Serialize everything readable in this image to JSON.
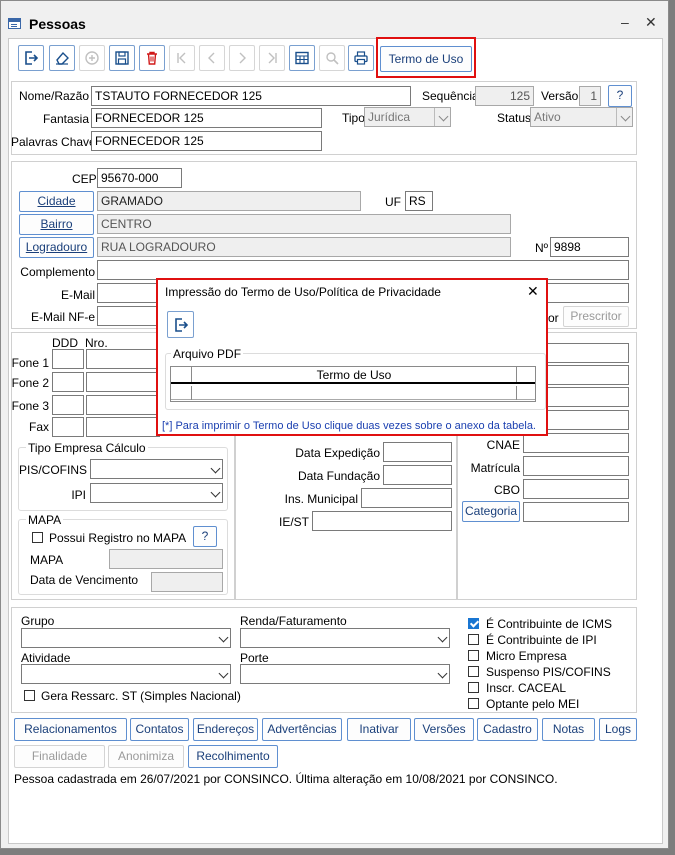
{
  "window": {
    "title": "Pessoas",
    "minimize": "–",
    "close": "✕"
  },
  "toolbar": {
    "termo_uso": "Termo de Uso"
  },
  "header": {
    "nome_label": "Nome/Razão",
    "nome_value": "TSTAUTO FORNECEDOR 125",
    "sequencia_label": "Sequência",
    "sequencia_value": "125",
    "versao_label": "Versão",
    "versao_value": "1",
    "help": "?",
    "fantasia_label": "Fantasia",
    "fantasia_value": "FORNECEDOR 125",
    "tipo_label": "Tipo",
    "tipo_value": "Jurídica",
    "status_label": "Status",
    "status_value": "Ativo",
    "palavras_label": "Palavras Chave",
    "palavras_value": "FORNECEDOR 125"
  },
  "address": {
    "cep_label": "CEP",
    "cep_value": "95670-000",
    "cidade_btn": "Cidade",
    "cidade_value": "GRAMADO",
    "uf_label": "UF",
    "uf_value": "RS",
    "bairro_btn": "Bairro",
    "bairro_value": "CENTRO",
    "logradouro_btn": "Logradouro",
    "logradouro_value": "RUA LOGRADOURO",
    "numero_label": "Nº",
    "numero_value": "9898",
    "complemento_label": "Complemento",
    "email_label": "E-Mail",
    "email_nfe_label": "E-Mail NF-e",
    "prescritor_suffix": "or",
    "prescritor_btn": "Prescritor"
  },
  "phones": {
    "ddd": "DDD",
    "nro": "Nro.",
    "fone1": "Fone 1",
    "fone2": "Fone 2",
    "fone3": "Fone 3",
    "fax": "Fax"
  },
  "tipo_empresa": {
    "title": "Tipo Empresa Cálculo",
    "pis_label": "PIS/COFINS",
    "ipi_label": "IPI"
  },
  "mapa": {
    "title": "MAPA",
    "possui_label": "Possui Registro no MAPA",
    "help": "?",
    "mapa_label": "MAPA",
    "vencimento_label": "Data de Vencimento"
  },
  "middle": {
    "data_expedicao": "Data Expedição",
    "data_fundacao": "Data Fundação",
    "ins_municipal": "Ins. Municipal",
    "ie_st": "IE/ST"
  },
  "right": {
    "cnae": "CNAE",
    "matricula": "Matrícula",
    "cbo": "CBO",
    "categoria_btn": "Categoria"
  },
  "bottom": {
    "grupo_label": "Grupo",
    "renda_label": "Renda/Faturamento",
    "atividade_label": "Atividade",
    "porte_label": "Porte",
    "gera_ressarc": "Gera Ressarc. ST (Simples Nacional)",
    "checkboxes": [
      {
        "label": "É Contribuinte de ICMS",
        "checked": true
      },
      {
        "label": "É Contribuinte de IPI",
        "checked": false
      },
      {
        "label": "Micro Empresa",
        "checked": false
      },
      {
        "label": "Suspenso PIS/COFINS",
        "checked": false
      },
      {
        "label": "Inscr. CACEAL",
        "checked": false
      },
      {
        "label": "Optante pelo MEI",
        "checked": false
      }
    ]
  },
  "actions": {
    "relacionamentos": "Relacionamentos",
    "contatos": "Contatos",
    "enderecos": "Endereços",
    "advertencias": "Advertências",
    "inativar": "Inativar",
    "versoes": "Versões",
    "cadastro": "Cadastro",
    "notas": "Notas",
    "logs": "Logs",
    "finalidade": "Finalidade",
    "anonimiza": "Anonimiza",
    "recolhimento": "Recolhimento"
  },
  "status_bar": "Pessoa cadastrada em 26/07/2021 por CONSINCO. Última alteração em 10/08/2021 por CONSINCO.",
  "dialog": {
    "title": "Impressão do Termo de Uso/Política de Privacidade",
    "close": "✕",
    "group_label": "Arquivo PDF",
    "column_header": "Termo de Uso",
    "hint": "[*] Para imprimir o Termo de Uso clique duas vezes sobre o anexo da tabela."
  },
  "colors": {
    "highlight_red": "#e01010",
    "button_border": "#5f8fd0",
    "link_blue": "#1a3fb0"
  }
}
